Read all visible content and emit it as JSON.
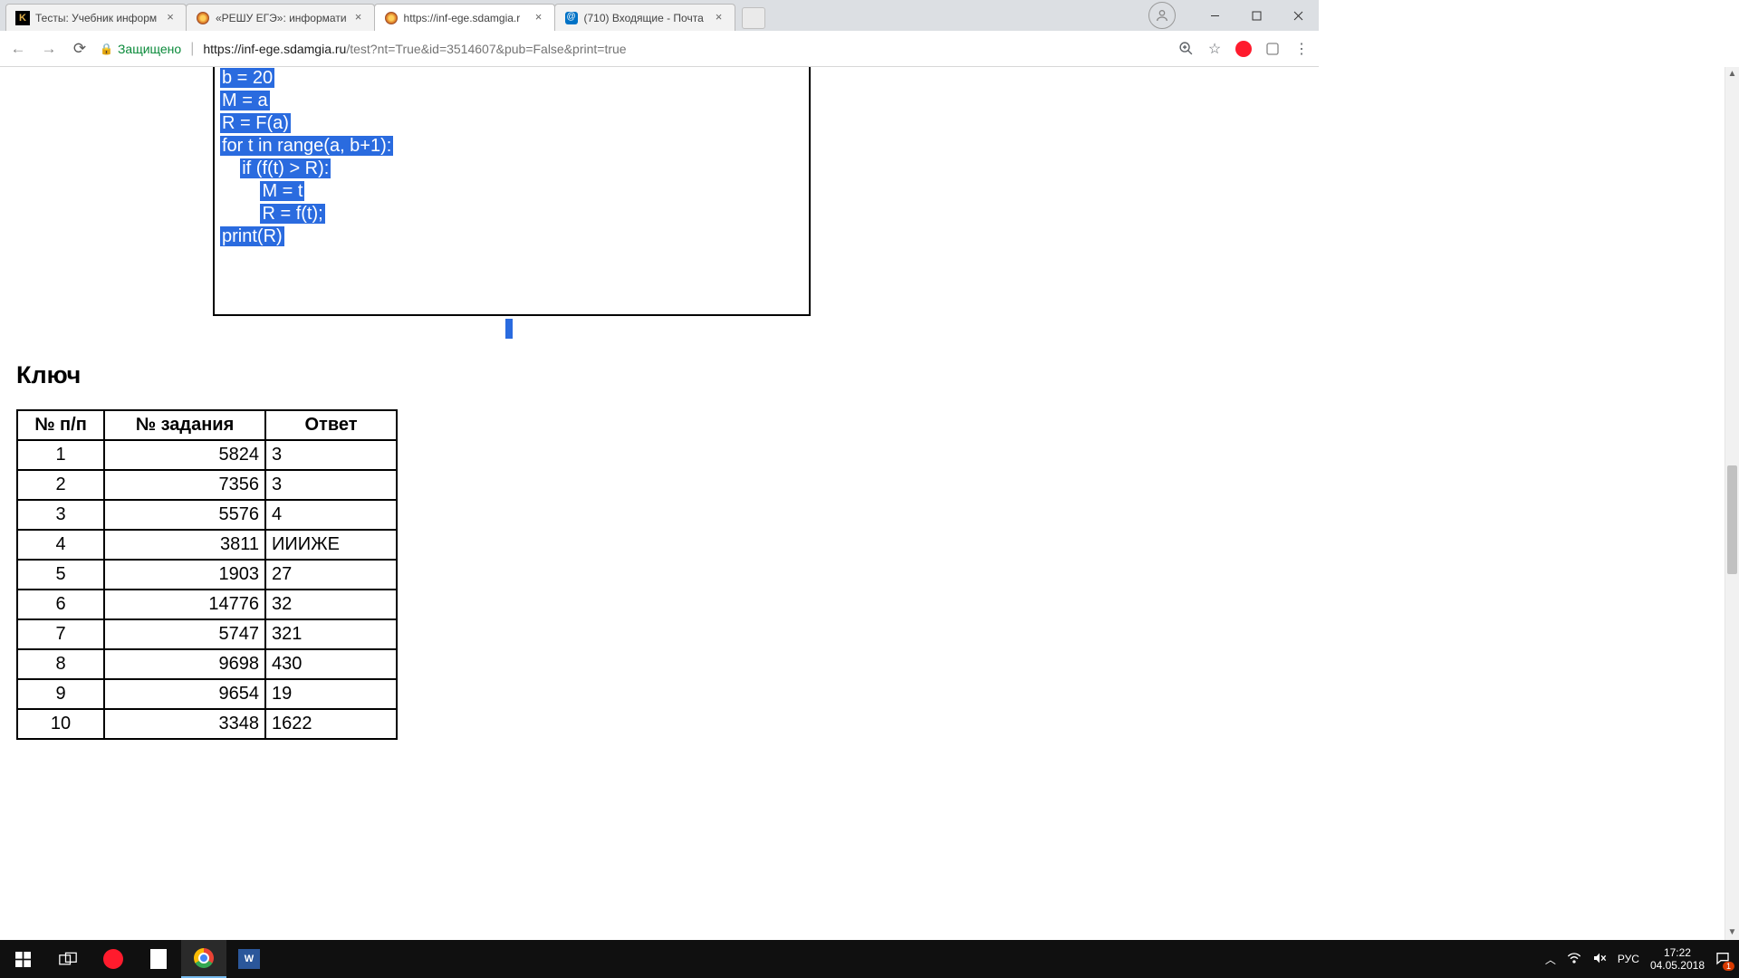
{
  "browser": {
    "tabs": [
      {
        "title": "Тесты: Учебник информ",
        "favicon": "K"
      },
      {
        "title": "«РЕШУ ЕГЭ»: информати",
        "favicon": "sun"
      },
      {
        "title": "https://inf-ege.sdamgia.r",
        "favicon": "sun",
        "active": true
      },
      {
        "title": "(710) Входящие - Почта",
        "favicon": "mail"
      }
    ],
    "secure_label": "Защищено",
    "url_host": "https://inf-ege.sdamgia.ru",
    "url_path": "/test?nt=True&id=3514607&pub=False&print=true"
  },
  "code_lines": [
    "b = 20",
    "M = a",
    "R = F(a)",
    "for t in range(a, b+1):",
    "    if (f(t) > R):",
    "        M = t",
    "        R = f(t);",
    "print(R)"
  ],
  "heading": "Ключ",
  "table": {
    "headers": [
      "№ п/п",
      "№ задания",
      "Ответ"
    ],
    "rows": [
      [
        "1",
        "5824",
        "3"
      ],
      [
        "2",
        "7356",
        "3"
      ],
      [
        "3",
        "5576",
        "4"
      ],
      [
        "4",
        "3811",
        "ИИИЖЕ"
      ],
      [
        "5",
        "1903",
        "27"
      ],
      [
        "6",
        "14776",
        "32"
      ],
      [
        "7",
        "5747",
        "321"
      ],
      [
        "8",
        "9698",
        "430"
      ],
      [
        "9",
        "9654",
        "19"
      ],
      [
        "10",
        "3348",
        "1622"
      ]
    ]
  },
  "taskbar": {
    "lang": "РУС",
    "time": "17:22",
    "date": "04.05.2018"
  }
}
